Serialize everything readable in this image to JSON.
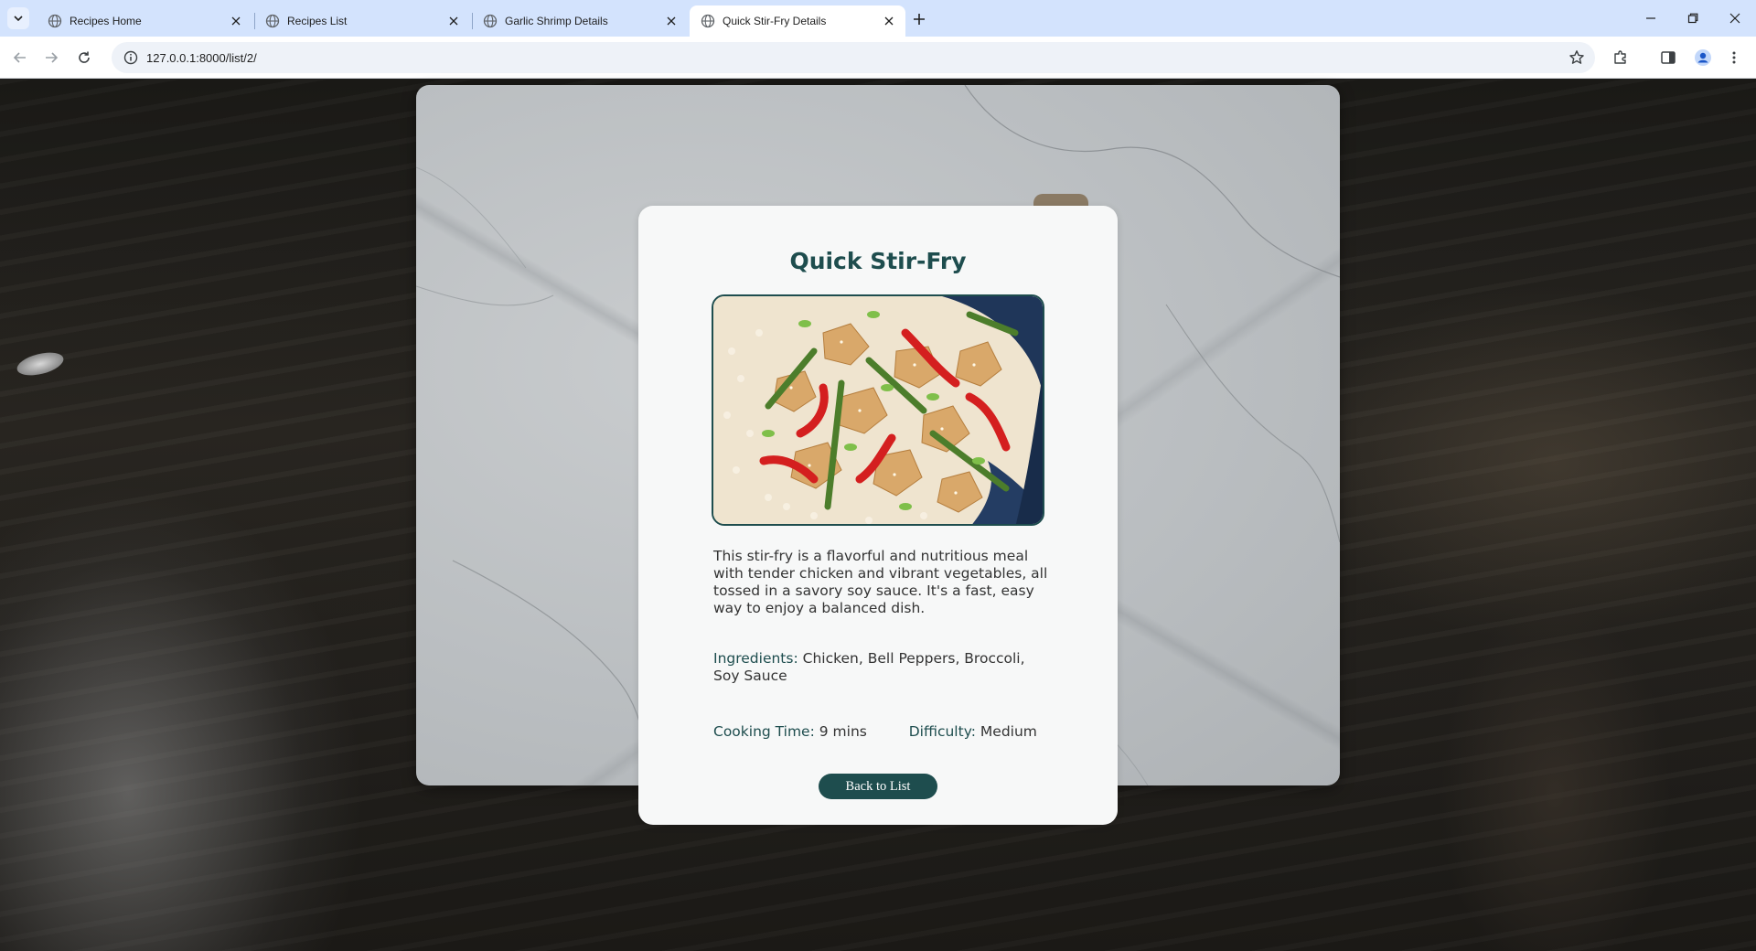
{
  "browser": {
    "tabs": [
      {
        "title": "Recipes Home",
        "active": false
      },
      {
        "title": "Recipes List",
        "active": false
      },
      {
        "title": "Garlic Shrimp Details",
        "active": false
      },
      {
        "title": "Quick Stir-Fry Details",
        "active": true
      }
    ],
    "url": "127.0.0.1:8000/list/2/"
  },
  "recipe": {
    "title": "Quick Stir-Fry",
    "image_alt": "Chicken stir-fry with bell peppers and asparagus over rice",
    "description": "This stir-fry is a flavorful and nutritious meal with tender chicken and vibrant vegetables, all tossed in a savory soy sauce. It's a fast, easy way to enjoy a balanced dish.",
    "ingredients_label": "Ingredients:",
    "ingredients": "Chicken, Bell Peppers, Broccoli, Soy Sauce",
    "cooking_time_label": "Cooking Time:",
    "cooking_time": "9 mins",
    "difficulty_label": "Difficulty:",
    "difficulty": "Medium",
    "back_label": "Back to List"
  },
  "colors": {
    "accent": "#1e4d4e",
    "tabstrip": "#d3e3fd"
  }
}
